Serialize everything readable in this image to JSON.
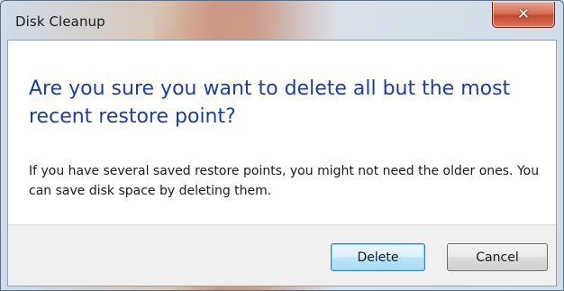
{
  "window": {
    "title": "Disk Cleanup",
    "close_glyph": "✕",
    "close_icon": "close-icon"
  },
  "dialog": {
    "main_instruction": "Are you sure you want to delete all but the most recent restore point?",
    "content": "If you have several saved restore points, you might not need the older ones. You can save disk space by deleting them."
  },
  "buttons": {
    "delete_label": "Delete",
    "cancel_label": "Cancel"
  },
  "colors": {
    "instruction_text": "#1f3f94",
    "close_button": "#c14a2e",
    "default_button_border": "#3c7fb1"
  }
}
